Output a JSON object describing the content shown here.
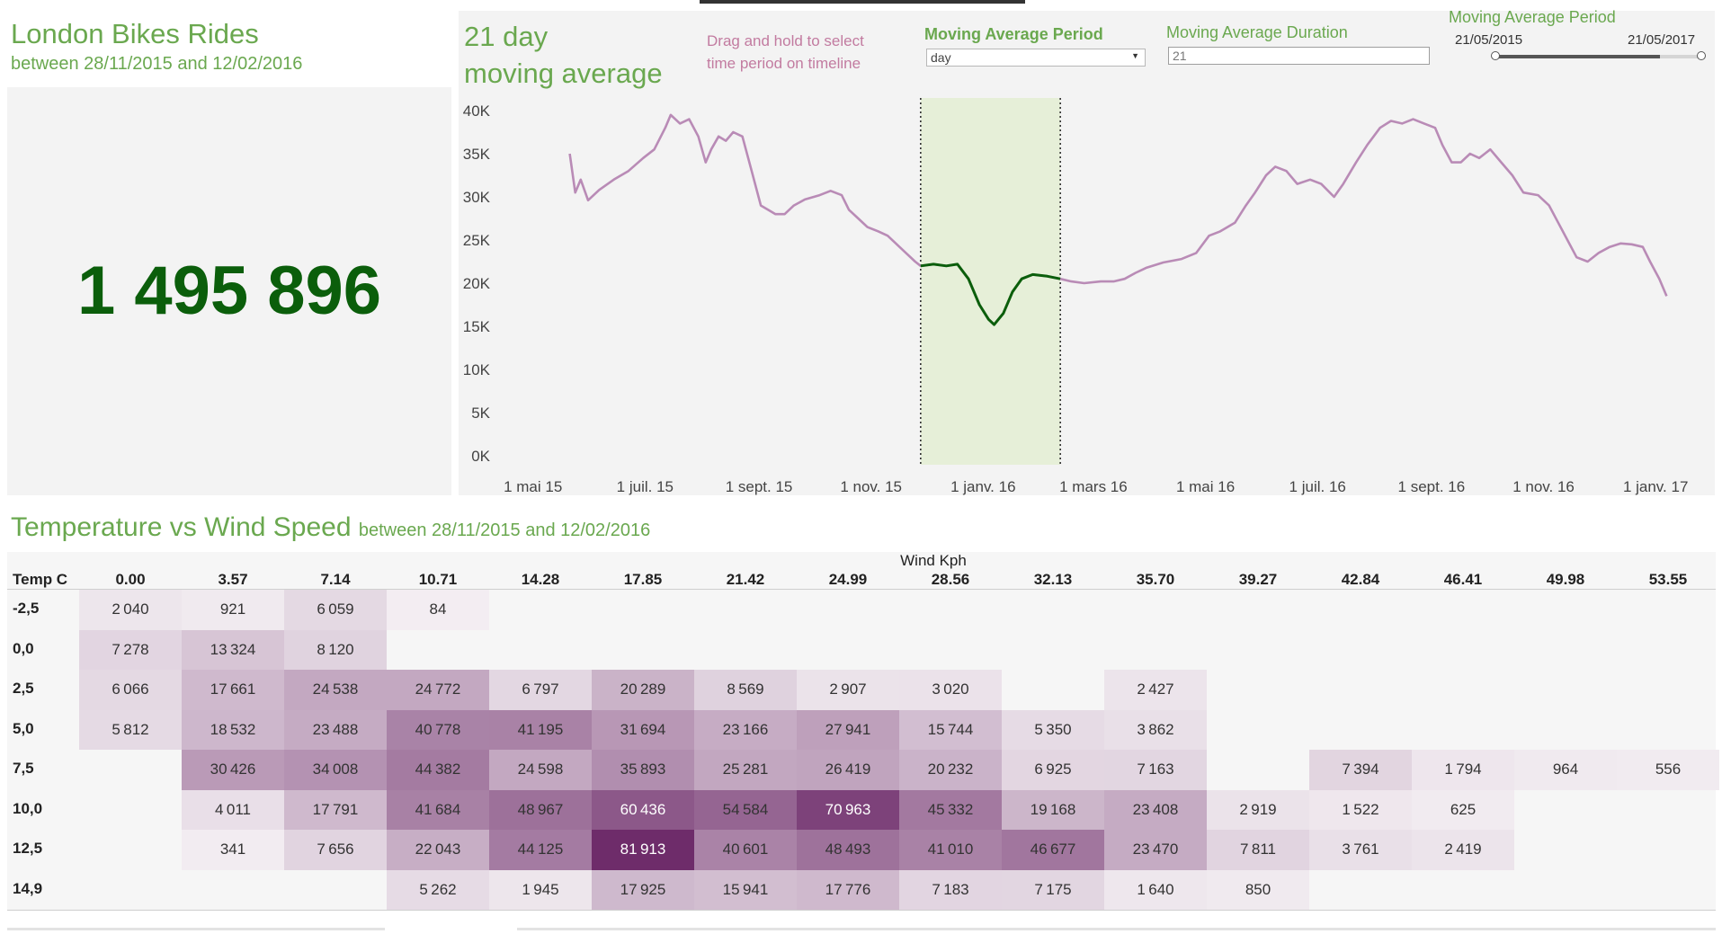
{
  "kpi": {
    "title": "London Bikes Rides",
    "subtitle": "between 28/11/2015 and 12/02/2016",
    "value": "1 495 896"
  },
  "line_panel": {
    "title_line1": "21 day",
    "title_line2": "moving average",
    "hint_line1": "Drag and hold to select",
    "hint_line2": "time period on timeline",
    "controls": {
      "period_label": "Moving Average Period",
      "period_value": "day",
      "duration_label": "Moving Average Duration",
      "duration_value": "21",
      "range_label": "Moving Average Period",
      "range_start": "21/05/2015",
      "range_end": "21/05/2017",
      "range_selection": [
        0.0,
        0.8
      ]
    }
  },
  "heatmap": {
    "title": "Temperature vs Wind Speed",
    "subtitle": "between 28/11/2015 and 12/02/2016",
    "col_axis_label": "Wind Kph",
    "row_axis_label": "Temp C",
    "columns": [
      "0.00",
      "3.57",
      "7.14",
      "10.71",
      "14.28",
      "17.85",
      "21.42",
      "24.99",
      "28.56",
      "32.13",
      "35.70",
      "39.27",
      "42.84",
      "46.41",
      "49.98",
      "53.55"
    ],
    "rows": [
      {
        "label": "-2,5",
        "values": [
          2040,
          921,
          6059,
          84,
          null,
          null,
          null,
          null,
          null,
          null,
          null,
          null,
          null,
          null,
          null,
          null
        ]
      },
      {
        "label": "0,0",
        "values": [
          7278,
          13324,
          8120,
          null,
          null,
          null,
          null,
          null,
          null,
          null,
          null,
          null,
          null,
          null,
          null,
          null
        ]
      },
      {
        "label": "2,5",
        "values": [
          6066,
          17661,
          24538,
          24772,
          6797,
          20289,
          8569,
          2907,
          3020,
          null,
          2427,
          null,
          null,
          null,
          null,
          null
        ]
      },
      {
        "label": "5,0",
        "values": [
          5812,
          18532,
          23488,
          40778,
          41195,
          31694,
          23166,
          27941,
          15744,
          5350,
          3862,
          null,
          null,
          null,
          null,
          null
        ]
      },
      {
        "label": "7,5",
        "values": [
          null,
          30426,
          34008,
          44382,
          24598,
          35893,
          25281,
          26419,
          20232,
          6925,
          7163,
          null,
          7394,
          1794,
          964,
          556
        ]
      },
      {
        "label": "10,0",
        "values": [
          null,
          4011,
          17791,
          41684,
          48967,
          60436,
          54584,
          70963,
          45332,
          19168,
          23408,
          2919,
          1522,
          625,
          null,
          null
        ]
      },
      {
        "label": "12,5",
        "values": [
          null,
          341,
          7656,
          22043,
          44125,
          81913,
          40601,
          48493,
          41010,
          46677,
          23470,
          7811,
          3761,
          2419,
          null,
          null
        ]
      },
      {
        "label": "14,9",
        "values": [
          null,
          null,
          null,
          5262,
          1945,
          17925,
          15941,
          17776,
          7183,
          7175,
          1640,
          850,
          null,
          null,
          null,
          null
        ]
      }
    ],
    "color_low": "#f3eef2",
    "color_high": "#6e2c6a"
  },
  "chart_data": {
    "type": "line",
    "title": "21 day moving average",
    "xlabel": "",
    "ylabel": "",
    "x_ticks": [
      "1 mai 15",
      "1 juil. 15",
      "1 sept. 15",
      "1 nov. 15",
      "1 janv. 16",
      "1 mars 16",
      "1 mai 16",
      "1 juil. 16",
      "1 sept. 16",
      "1 nov. 16",
      "1 janv. 17"
    ],
    "y_ticks": [
      "0K",
      "5K",
      "10K",
      "15K",
      "20K",
      "25K",
      "30K",
      "35K",
      "40K"
    ],
    "ylim": [
      0,
      40000
    ],
    "x_start": "2015-04-15",
    "x_end": "2017-01-20",
    "highlight": {
      "start": "2015-11-28",
      "end": "2016-02-12",
      "fill": "#e6efd8"
    },
    "colors": {
      "series": "#b98bb6",
      "highlight": "#0b5e0b"
    },
    "series": [
      {
        "points": [
          [
            "2015-05-21",
            35000
          ],
          [
            "2015-05-24",
            30500
          ],
          [
            "2015-05-27",
            32000
          ],
          [
            "2015-05-31",
            29600
          ],
          [
            "2015-06-06",
            30800
          ],
          [
            "2015-06-14",
            32000
          ],
          [
            "2015-06-22",
            33000
          ],
          [
            "2015-06-30",
            34500
          ],
          [
            "2015-07-06",
            35500
          ],
          [
            "2015-07-12",
            38000
          ],
          [
            "2015-07-15",
            39500
          ],
          [
            "2015-07-20",
            38500
          ],
          [
            "2015-07-25",
            39000
          ],
          [
            "2015-07-30",
            37000
          ],
          [
            "2015-08-03",
            34000
          ],
          [
            "2015-08-06",
            35500
          ],
          [
            "2015-08-10",
            37000
          ],
          [
            "2015-08-14",
            36500
          ],
          [
            "2015-08-18",
            37500
          ],
          [
            "2015-08-23",
            37000
          ],
          [
            "2015-08-28",
            33000
          ],
          [
            "2015-09-02",
            29000
          ],
          [
            "2015-09-06",
            28500
          ],
          [
            "2015-09-10",
            28000
          ],
          [
            "2015-09-15",
            28000
          ],
          [
            "2015-09-20",
            29000
          ],
          [
            "2015-09-26",
            29700
          ],
          [
            "2015-10-04",
            30200
          ],
          [
            "2015-10-10",
            30700
          ],
          [
            "2015-10-16",
            30200
          ],
          [
            "2015-10-20",
            28500
          ],
          [
            "2015-10-25",
            27500
          ],
          [
            "2015-10-30",
            26500
          ],
          [
            "2015-11-05",
            26000
          ],
          [
            "2015-11-10",
            25500
          ],
          [
            "2015-11-15",
            24500
          ],
          [
            "2015-11-20",
            23500
          ],
          [
            "2015-11-25",
            22500
          ],
          [
            "2015-11-28",
            22000
          ],
          [
            "2015-12-05",
            22200
          ],
          [
            "2015-12-12",
            22000
          ],
          [
            "2015-12-18",
            22200
          ],
          [
            "2015-12-24",
            20500
          ],
          [
            "2015-12-30",
            17500
          ],
          [
            "2016-01-04",
            15800
          ],
          [
            "2016-01-07",
            15200
          ],
          [
            "2016-01-12",
            16500
          ],
          [
            "2016-01-17",
            19000
          ],
          [
            "2016-01-22",
            20500
          ],
          [
            "2016-01-28",
            21000
          ],
          [
            "2016-02-05",
            20800
          ],
          [
            "2016-02-12",
            20500
          ],
          [
            "2016-02-18",
            20200
          ],
          [
            "2016-02-25",
            20000
          ],
          [
            "2016-03-05",
            20200
          ],
          [
            "2016-03-12",
            20200
          ],
          [
            "2016-03-18",
            20500
          ],
          [
            "2016-03-24",
            21200
          ],
          [
            "2016-03-30",
            21800
          ],
          [
            "2016-04-08",
            22400
          ],
          [
            "2016-04-18",
            22800
          ],
          [
            "2016-04-26",
            23500
          ],
          [
            "2016-05-03",
            25500
          ],
          [
            "2016-05-09",
            26000
          ],
          [
            "2016-05-17",
            27000
          ],
          [
            "2016-05-23",
            29000
          ],
          [
            "2016-05-28",
            30500
          ],
          [
            "2016-06-03",
            32500
          ],
          [
            "2016-06-08",
            33500
          ],
          [
            "2016-06-14",
            33000
          ],
          [
            "2016-06-20",
            31500
          ],
          [
            "2016-06-27",
            32000
          ],
          [
            "2016-07-03",
            31500
          ],
          [
            "2016-07-10",
            30000
          ],
          [
            "2016-07-15",
            31500
          ],
          [
            "2016-07-22",
            34000
          ],
          [
            "2016-07-28",
            36000
          ],
          [
            "2016-08-04",
            38000
          ],
          [
            "2016-08-10",
            38800
          ],
          [
            "2016-08-16",
            38500
          ],
          [
            "2016-08-22",
            39000
          ],
          [
            "2016-08-28",
            38500
          ],
          [
            "2016-09-03",
            38000
          ],
          [
            "2016-09-07",
            36000
          ],
          [
            "2016-09-12",
            34000
          ],
          [
            "2016-09-17",
            34000
          ],
          [
            "2016-09-22",
            35000
          ],
          [
            "2016-09-27",
            34500
          ],
          [
            "2016-10-03",
            35500
          ],
          [
            "2016-10-09",
            34000
          ],
          [
            "2016-10-15",
            32500
          ],
          [
            "2016-10-21",
            30500
          ],
          [
            "2016-10-29",
            30200
          ],
          [
            "2016-11-04",
            29000
          ],
          [
            "2016-11-09",
            27000
          ],
          [
            "2016-11-14",
            25000
          ],
          [
            "2016-11-19",
            23000
          ],
          [
            "2016-11-25",
            22500
          ],
          [
            "2016-12-01",
            23500
          ],
          [
            "2016-12-07",
            24200
          ],
          [
            "2016-12-13",
            24600
          ],
          [
            "2016-12-19",
            24500
          ],
          [
            "2016-12-25",
            24200
          ],
          [
            "2016-12-29",
            22500
          ],
          [
            "2017-01-03",
            20500
          ],
          [
            "2017-01-07",
            18500
          ]
        ]
      }
    ]
  }
}
